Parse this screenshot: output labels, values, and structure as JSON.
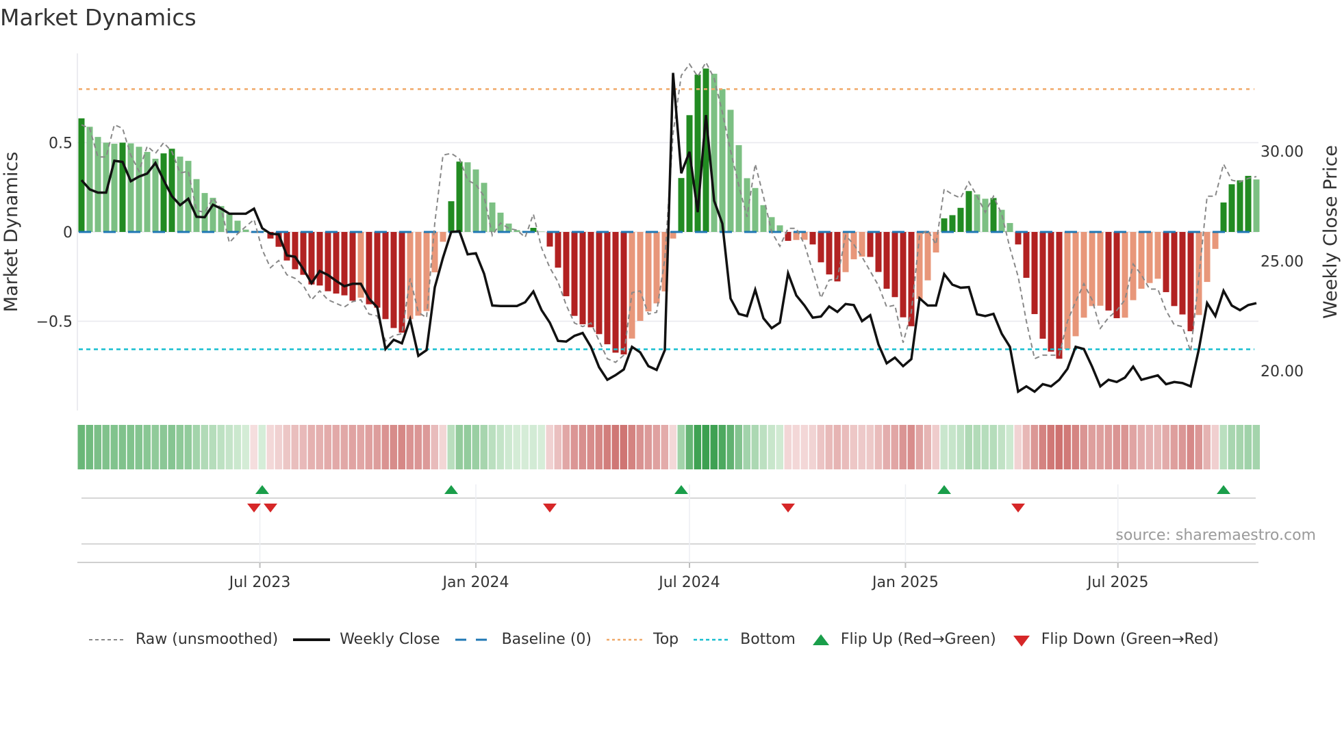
{
  "title": "Market Dynamics",
  "source": "source: sharemaestro.com",
  "colors": {
    "green_strong": "#228b22",
    "green_soft": "#7cc083",
    "red_strong": "#b22222",
    "red_soft": "#e8977a",
    "raw": "#888888",
    "close": "#111111",
    "baseline": "#1f77b4",
    "top": "#f0a868",
    "bottom": "#17becf",
    "flip_up": "#1a9e4a",
    "flip_down": "#d62728",
    "grid": "#e8e8ee"
  },
  "chart_data": {
    "type": "bar",
    "title": "Market Dynamics",
    "xlabel": "",
    "ylabel": "Market Dynamics",
    "y2label": "Weekly Close Price",
    "ylim": [
      -1.0,
      1.0
    ],
    "y2lim": [
      18.2,
      34.46
    ],
    "grid": true,
    "legend_position": "bottom",
    "start_date": "2023-01-30",
    "frequency": "weekly",
    "yticks": [
      {
        "value": 0.5,
        "label": "0.5"
      },
      {
        "value": 0,
        "label": "0"
      },
      {
        "value": -0.5,
        "label": "−0.5"
      }
    ],
    "y2ticks": [
      {
        "value": 30,
        "label": "30.00"
      },
      {
        "value": 25,
        "label": "25.00"
      },
      {
        "value": 20,
        "label": "20.00"
      }
    ],
    "xticks": [
      {
        "date": "2023-07-01",
        "label": "Jul 2023"
      },
      {
        "date": "2024-01-01",
        "label": "Jan 2024"
      },
      {
        "date": "2024-07-01",
        "label": "Jul 2024"
      },
      {
        "date": "2025-01-01",
        "label": "Jan 2025"
      },
      {
        "date": "2025-07-01",
        "label": "Jul 2025"
      }
    ],
    "top_threshold": 0.8,
    "bottom_threshold": -0.657,
    "baseline": 0,
    "dynamics": [
      0.636,
      0.589,
      0.532,
      0.5,
      0.494,
      0.5,
      0.496,
      0.477,
      0.448,
      0.41,
      0.44,
      0.466,
      0.422,
      0.398,
      0.296,
      0.218,
      0.191,
      0.145,
      0.1,
      0.063,
      0.013,
      -0.003,
      0.003,
      -0.037,
      -0.083,
      -0.16,
      -0.209,
      -0.24,
      -0.294,
      -0.3,
      -0.332,
      -0.345,
      -0.355,
      -0.385,
      -0.368,
      -0.405,
      -0.424,
      -0.488,
      -0.538,
      -0.564,
      -0.488,
      -0.469,
      -0.443,
      -0.226,
      -0.055,
      0.172,
      0.394,
      0.39,
      0.35,
      0.275,
      0.165,
      0.108,
      0.047,
      0.01,
      0.006,
      0.023,
      0.002,
      -0.082,
      -0.2,
      -0.36,
      -0.47,
      -0.517,
      -0.534,
      -0.572,
      -0.629,
      -0.676,
      -0.686,
      -0.597,
      -0.498,
      -0.445,
      -0.4,
      -0.333,
      -0.037,
      0.302,
      0.654,
      0.881,
      0.915,
      0.886,
      0.8,
      0.684,
      0.486,
      0.301,
      0.246,
      0.15,
      0.083,
      0.037,
      -0.05,
      -0.045,
      -0.044,
      -0.07,
      -0.17,
      -0.238,
      -0.277,
      -0.225,
      -0.153,
      -0.138,
      -0.14,
      -0.224,
      -0.318,
      -0.365,
      -0.478,
      -0.528,
      -0.375,
      -0.271,
      -0.115,
      0.076,
      0.094,
      0.135,
      0.229,
      0.21,
      0.186,
      0.19,
      0.124,
      0.05,
      -0.07,
      -0.257,
      -0.46,
      -0.598,
      -0.67,
      -0.71,
      -0.656,
      -0.584,
      -0.48,
      -0.415,
      -0.413,
      -0.44,
      -0.483,
      -0.48,
      -0.382,
      -0.318,
      -0.286,
      -0.262,
      -0.337,
      -0.415,
      -0.462,
      -0.556,
      -0.465,
      -0.28,
      -0.095,
      0.165,
      0.267,
      0.289,
      0.314,
      0.294
    ],
    "raw": [
      0.6,
      0.58,
      0.42,
      0.42,
      0.6,
      0.58,
      0.43,
      0.34,
      0.48,
      0.44,
      0.5,
      0.45,
      0.33,
      0.34,
      0.12,
      0.11,
      0.19,
      0.13,
      -0.06,
      -0.01,
      0.03,
      0.07,
      -0.1,
      -0.2,
      -0.16,
      -0.24,
      -0.26,
      -0.3,
      -0.38,
      -0.33,
      -0.38,
      -0.4,
      -0.42,
      -0.39,
      -0.38,
      -0.46,
      -0.47,
      -0.61,
      -0.58,
      -0.57,
      -0.26,
      -0.45,
      -0.48,
      0.05,
      0.43,
      0.44,
      0.41,
      0.29,
      0.265,
      0.2,
      -0.02,
      0.05,
      0.02,
      0.01,
      -0.03,
      0.1,
      -0.09,
      -0.2,
      -0.28,
      -0.41,
      -0.51,
      -0.53,
      -0.51,
      -0.61,
      -0.71,
      -0.73,
      -0.69,
      -0.34,
      -0.33,
      -0.46,
      -0.45,
      -0.15,
      0.55,
      0.876,
      0.94,
      0.87,
      0.95,
      0.86,
      0.67,
      0.455,
      0.26,
      0.085,
      0.38,
      0.2,
      0.0,
      -0.08,
      0.02,
      0.02,
      -0.07,
      -0.22,
      -0.37,
      -0.27,
      -0.26,
      -0.02,
      -0.07,
      -0.14,
      -0.22,
      -0.3,
      -0.42,
      -0.41,
      -0.62,
      -0.45,
      -0.02,
      0.01,
      -0.07,
      0.24,
      0.21,
      0.19,
      0.28,
      0.2,
      0.11,
      0.2,
      0.1,
      -0.09,
      -0.25,
      -0.5,
      -0.71,
      -0.69,
      -0.69,
      -0.69,
      -0.5,
      -0.39,
      -0.29,
      -0.38,
      -0.54,
      -0.48,
      -0.44,
      -0.38,
      -0.18,
      -0.24,
      -0.32,
      -0.32,
      -0.44,
      -0.52,
      -0.53,
      -0.67,
      -0.25,
      0.2,
      0.2,
      0.38,
      0.29,
      0.28,
      0.3,
      0.31
    ],
    "close": [
      28.69,
      28.27,
      28.12,
      28.12,
      29.57,
      29.52,
      28.64,
      28.85,
      28.99,
      29.47,
      28.69,
      27.96,
      27.55,
      27.84,
      27.02,
      27.0,
      27.57,
      27.39,
      27.16,
      27.16,
      27.16,
      27.39,
      26.5,
      26.25,
      26.22,
      25.26,
      25.2,
      24.64,
      24.0,
      24.55,
      24.37,
      24.1,
      23.86,
      23.97,
      23.97,
      23.29,
      22.9,
      21.0,
      21.42,
      21.26,
      22.35,
      20.69,
      20.95,
      23.81,
      25.16,
      26.33,
      26.36,
      25.31,
      25.36,
      24.43,
      22.98,
      22.96,
      22.96,
      22.96,
      23.13,
      23.62,
      22.77,
      22.2,
      21.37,
      21.34,
      21.6,
      21.73,
      21.1,
      20.17,
      19.6,
      19.81,
      20.07,
      21.1,
      20.85,
      20.22,
      20.05,
      20.95,
      33.57,
      29.0,
      29.98,
      27.23,
      31.65,
      27.75,
      26.71,
      23.3,
      22.6,
      22.5,
      23.7,
      22.4,
      21.95,
      22.2,
      24.45,
      23.44,
      22.98,
      22.43,
      22.48,
      22.94,
      22.69,
      23.05,
      23.0,
      22.27,
      22.54,
      21.21,
      20.35,
      20.61,
      20.22,
      20.54,
      23.31,
      22.98,
      22.98,
      24.41,
      23.93,
      23.79,
      23.82,
      22.58,
      22.5,
      22.6,
      21.7,
      21.1,
      19.06,
      19.3,
      19.06,
      19.4,
      19.3,
      19.6,
      20.1,
      21.1,
      21.0,
      20.2,
      19.3,
      19.6,
      19.5,
      19.7,
      20.2,
      19.6,
      19.7,
      19.8,
      19.4,
      19.5,
      19.45,
      19.3,
      21.0,
      23.09,
      22.5,
      23.65,
      22.98,
      22.77,
      23.0,
      23.09
    ],
    "flips_up": [
      "2023-07-03",
      "2023-12-11",
      "2024-06-24",
      "2025-02-03",
      "2025-09-29"
    ],
    "flips_down": [
      "2023-06-26",
      "2023-07-10",
      "2024-03-04",
      "2024-09-23",
      "2025-04-07"
    ],
    "legend": [
      {
        "key": "raw",
        "label": "Raw (unsmoothed)"
      },
      {
        "key": "close",
        "label": "Weekly Close"
      },
      {
        "key": "baseline",
        "label": "Baseline (0)"
      },
      {
        "key": "top",
        "label": "Top"
      },
      {
        "key": "bottom",
        "label": "Bottom"
      },
      {
        "key": "flip_up",
        "label": "Flip Up (Red→Green)"
      },
      {
        "key": "flip_down",
        "label": "Flip Down (Green→Red)"
      }
    ]
  }
}
